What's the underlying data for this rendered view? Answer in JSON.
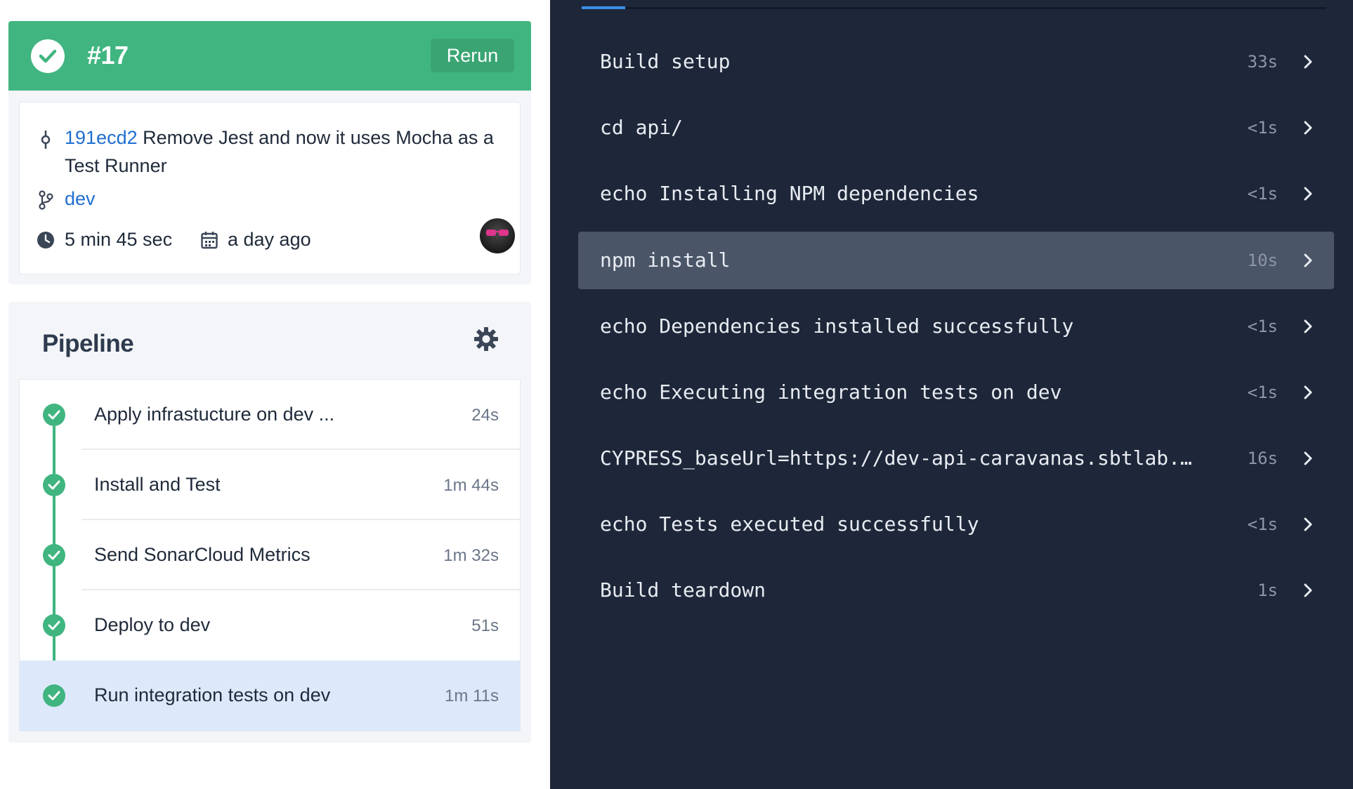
{
  "top_crumb": "… / … / …",
  "build": {
    "number": "#17",
    "rerun_label": "Rerun",
    "status_color": "#40b580",
    "commit_hash": "191ecd2",
    "commit_message": "Remove Jest and now it uses Mocha as a Test Runner",
    "branch": "dev",
    "duration": "5 min 45 sec",
    "date": "a day ago"
  },
  "pipeline": {
    "title": "Pipeline",
    "steps": [
      {
        "label": "Apply infrastucture on dev ...",
        "time": "24s"
      },
      {
        "label": "Install and Test",
        "time": "1m 44s"
      },
      {
        "label": "Send SonarCloud Metrics",
        "time": "1m 32s"
      },
      {
        "label": "Deploy to dev",
        "time": "51s"
      },
      {
        "label": "Run integration tests on dev",
        "time": "1m 11s",
        "active": true
      }
    ]
  },
  "log": {
    "commands": [
      {
        "text": "Build setup",
        "time": "33s"
      },
      {
        "text": "cd api/",
        "time": "<1s"
      },
      {
        "text": "echo Installing NPM dependencies",
        "time": "<1s"
      },
      {
        "text": "npm install",
        "time": "10s",
        "active": true
      },
      {
        "text": "echo Dependencies installed successfully",
        "time": "<1s"
      },
      {
        "text": "echo Executing integration tests on dev",
        "time": "<1s"
      },
      {
        "text": "CYPRESS_baseUrl=https://dev-api-caravanas.sbtlab.…",
        "time": "16s"
      },
      {
        "text": "echo Tests executed successfully",
        "time": "<1s"
      },
      {
        "text": "Build teardown",
        "time": "1s"
      }
    ]
  },
  "colors": {
    "success": "#40b580",
    "link": "#1f6fd0",
    "log_background": "#1e2739",
    "active_row": "#4a5568",
    "active_step": "#dde9fb",
    "tab_accent": "#3d8fe6"
  }
}
